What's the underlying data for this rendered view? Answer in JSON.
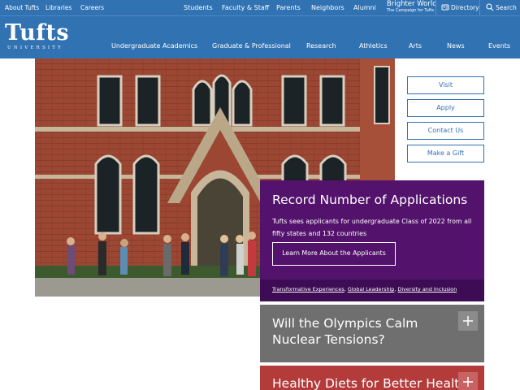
{
  "utility_bar": {
    "left_links": [
      "About Tufts",
      "Libraries",
      "Careers"
    ],
    "audience_links": [
      "Students",
      "Faculty & Staff",
      "Parents",
      "Neighbors",
      "Alumni"
    ],
    "brighter_world_title": "Brighter World",
    "brighter_world_sub": "The Campaign for Tufts",
    "directory_label": "Directory",
    "search_label": "Search"
  },
  "logo": {
    "name": "Tufts",
    "sub": "UNIVERSITY"
  },
  "main_nav": [
    "Undergraduate Academics",
    "Graduate & Professional",
    "Research",
    "Athletics",
    "Arts",
    "News",
    "Events"
  ],
  "cta_buttons": [
    "Visit",
    "Apply",
    "Contact Us",
    "Make a Gift"
  ],
  "feature": {
    "title": "Record Number of Applications",
    "body": "Tufts sees applicants for undergraduate Class of 2022 from all fifty states and 132 countries",
    "button": "Learn More About the Applicants",
    "footer_links": [
      "Transformative Experiences",
      "Global Leadership",
      "Diversity and Inclusion"
    ]
  },
  "story_1": {
    "title": "Will the Olympics Calm Nuclear Tensions?"
  },
  "story_2": {
    "title": "Healthy Diets for Better Health"
  },
  "colors": {
    "brand_blue": "#3172b3",
    "feature_purple": "#53126b",
    "story_gray": "#6f6f70",
    "story_red": "#b33b3a"
  },
  "icons": [
    "directory-icon",
    "search-icon",
    "plus-icon"
  ]
}
